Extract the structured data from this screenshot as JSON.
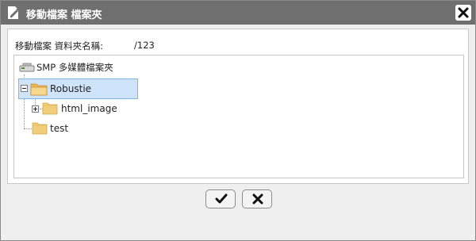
{
  "window": {
    "title": "移動檔案 檔案夾",
    "title_icon": "edit-document-icon",
    "close_icon": "close-icon"
  },
  "form": {
    "label": "移動檔案 資料夾名稱:",
    "value": "/123"
  },
  "tree": {
    "root": {
      "label": "SMP 多媒體檔案夾",
      "icon": "drive-icon"
    },
    "nodes": [
      {
        "label": "Robustie",
        "selected": true,
        "expanded": true,
        "icon": "folder-open-icon"
      },
      {
        "label": "html_image",
        "selected": false,
        "expanded": false,
        "icon": "folder-icon"
      },
      {
        "label": "test",
        "selected": false,
        "expanded": false,
        "icon": "folder-icon"
      }
    ]
  },
  "buttons": {
    "ok_icon": "checkmark-icon",
    "cancel_icon": "x-icon"
  },
  "colors": {
    "titlebar": "#6f6f6f",
    "selection_bg": "#cfe3fb",
    "selection_border": "#7eb4ea",
    "folder": "#f1ce7a"
  }
}
